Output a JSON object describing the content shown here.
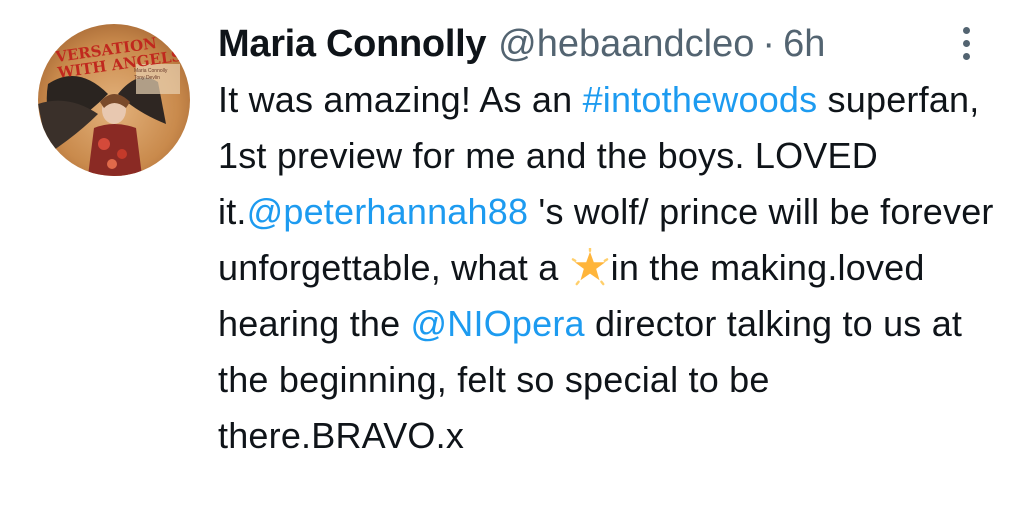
{
  "avatar": {
    "line1": "VERSATION",
    "line2": "WITH ANGELS",
    "small1": "Maria Connolly",
    "small2": "Tony Devlin"
  },
  "author": {
    "name": "Maria Connolly",
    "handle": "@hebaandcleo",
    "separator": "·",
    "time": "6h"
  },
  "menu": {
    "icon": "more-vertical-icon"
  },
  "tweet": {
    "p1": "It was amazing! As an ",
    "hashtag": "#intothewoods",
    "p2": " superfan, 1st preview for me and the boys. LOVED it.",
    "mention1": "@peterhannah88",
    "p3": " 's wolf/ prince will be forever unforgettable, what a ",
    "emoji": "star-emoji",
    "p4": "in the making.loved hearing the ",
    "mention2": "@NIOpera",
    "p5": " director talking to us at the beginning, felt so special to be there.BRAVO.x"
  },
  "colors": {
    "link": "#1d9bf0",
    "text": "#0f1419",
    "secondary": "#536471"
  }
}
